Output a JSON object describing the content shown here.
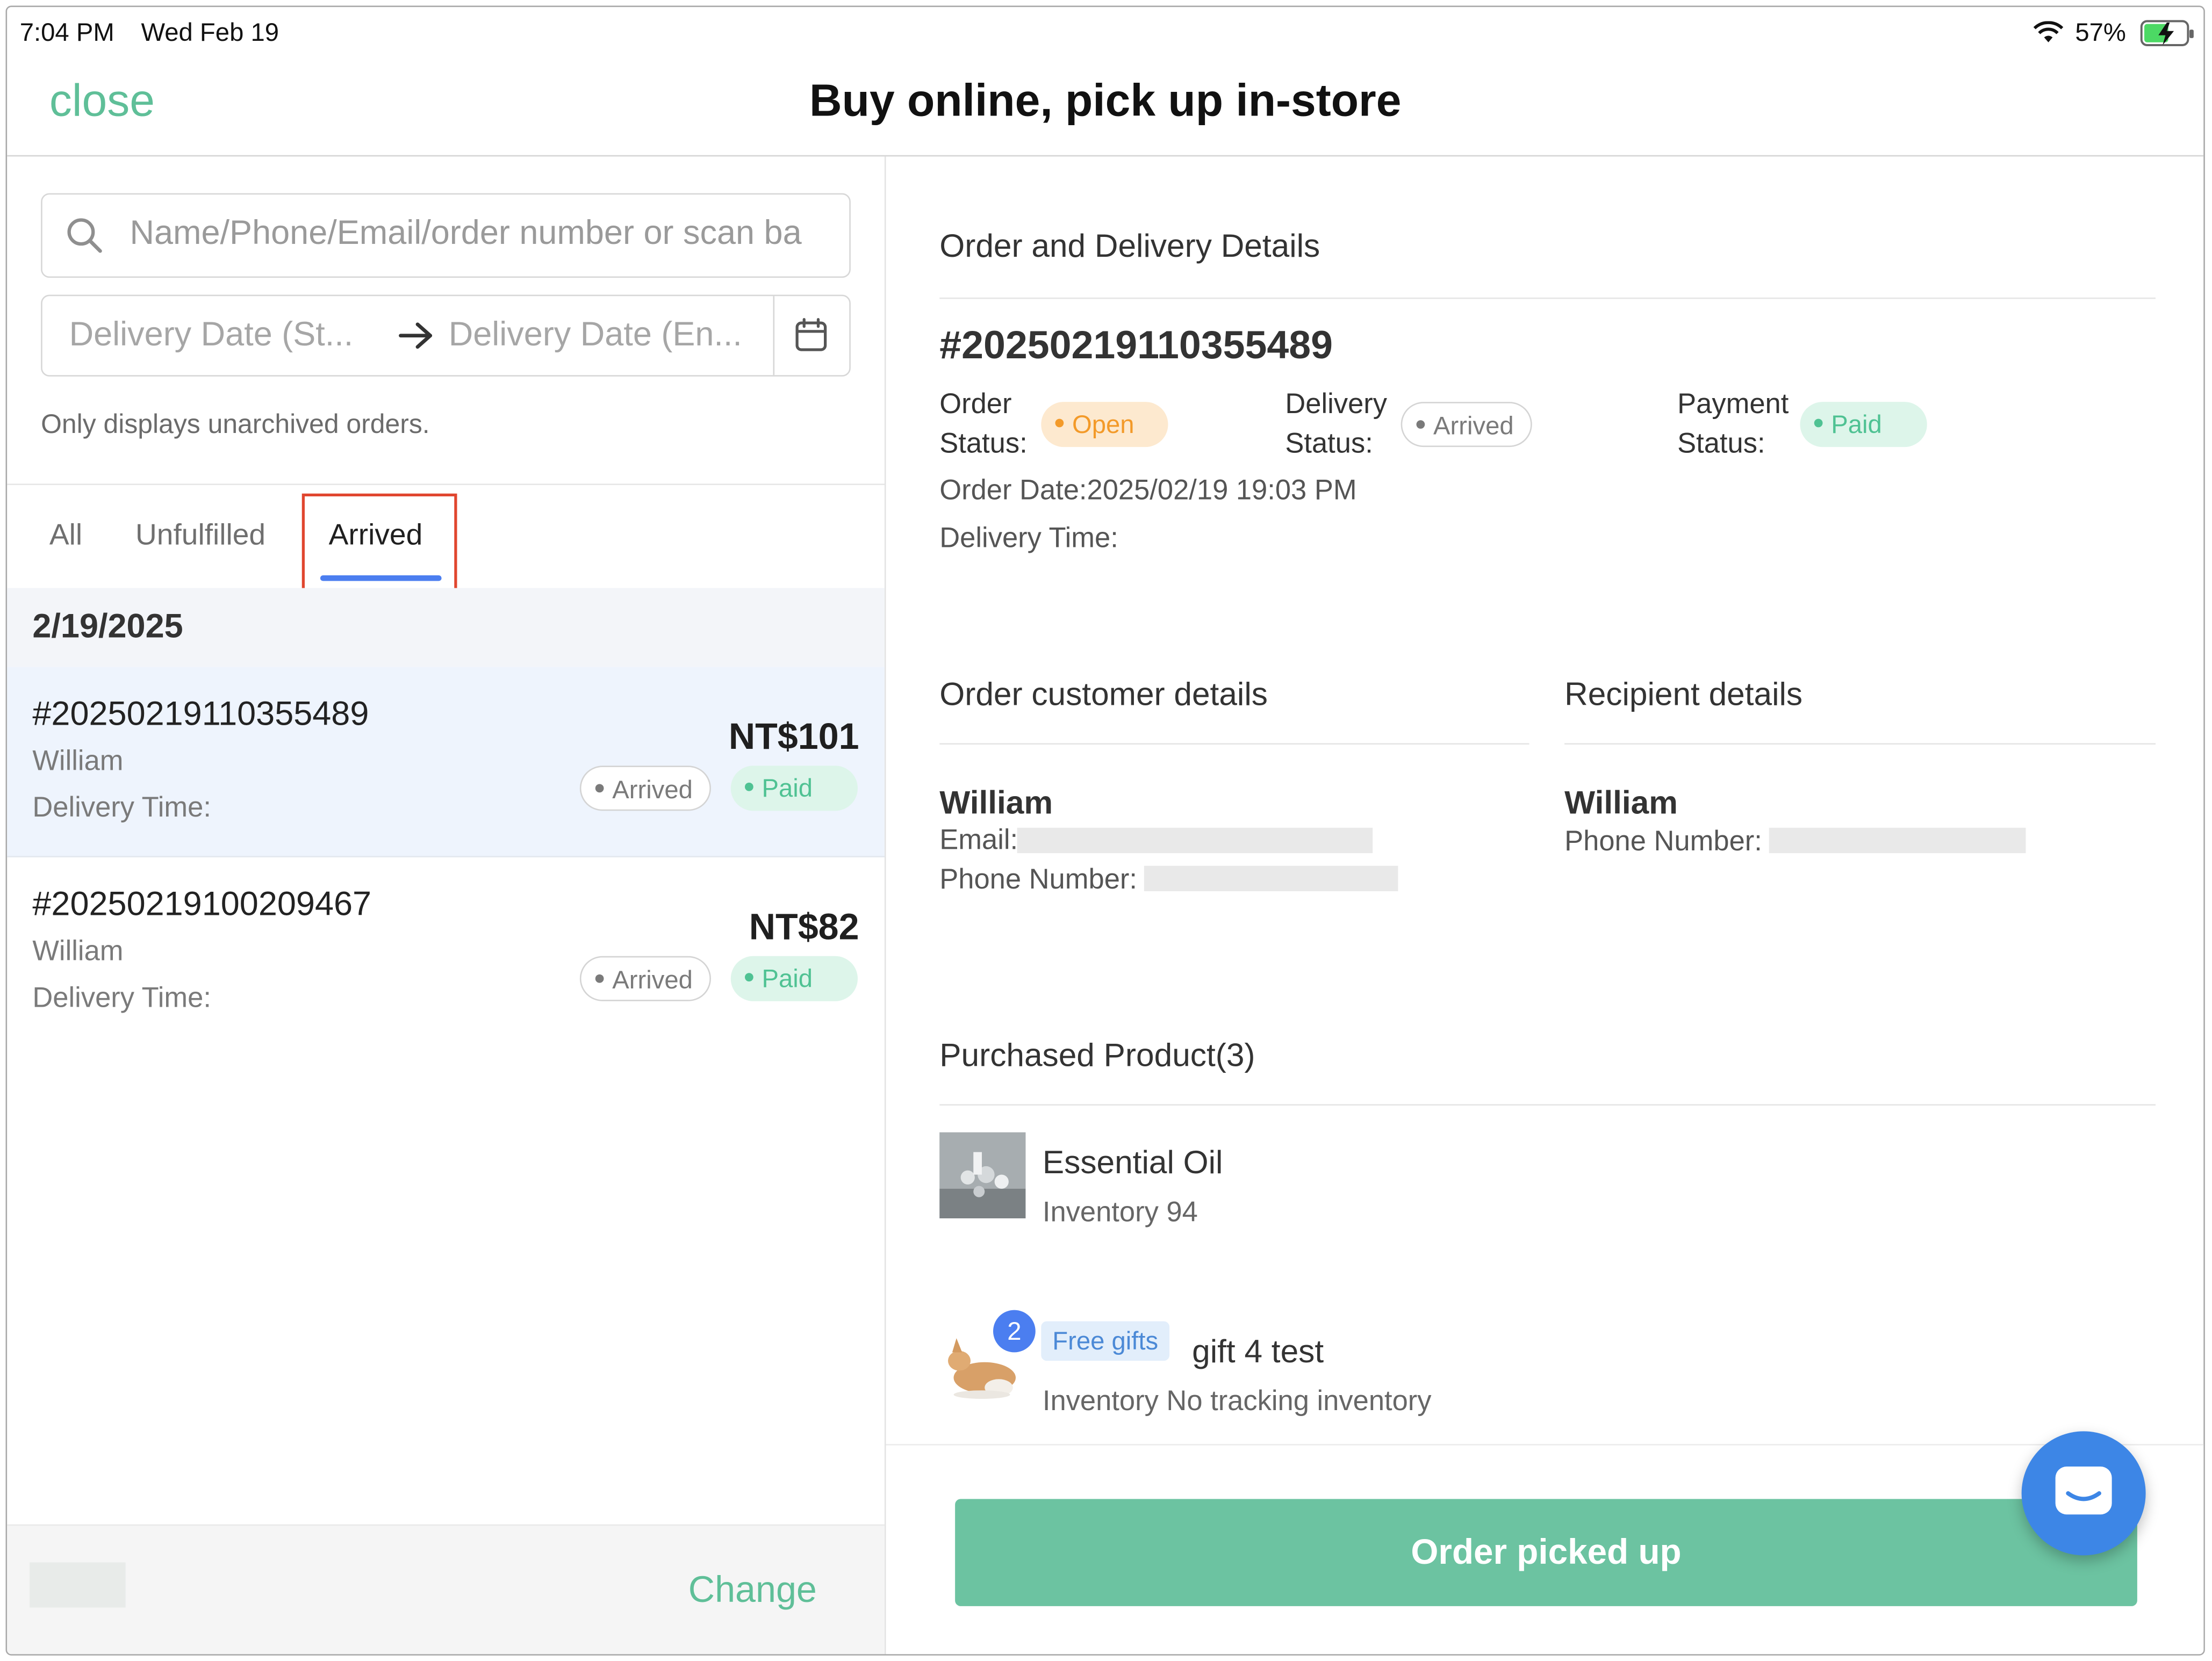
{
  "status_bar": {
    "time": "7:04 PM",
    "date": "Wed Feb 19",
    "battery": "57%"
  },
  "header": {
    "close_label": "close",
    "title": "Buy online, pick up in-store"
  },
  "left": {
    "search_placeholder": "Name/Phone/Email/order number or scan ba",
    "date_start_placeholder": "Delivery Date (St...",
    "date_end_placeholder": "Delivery Date (En...",
    "hint": "Only displays unarchived orders.",
    "tabs": [
      "All",
      "Unfulfilled",
      "Arrived"
    ],
    "active_tab": "Arrived",
    "group_date": "2/19/2025",
    "orders": [
      {
        "number": "#20250219110355489",
        "customer": "William",
        "delivery_time_label": "Delivery Time:",
        "amount": "NT$101",
        "delivery_status": "Arrived",
        "payment_status": "Paid",
        "selected": true
      },
      {
        "number": "#20250219100209467",
        "customer": "William",
        "delivery_time_label": "Delivery Time:",
        "amount": "NT$82",
        "delivery_status": "Arrived",
        "payment_status": "Paid",
        "selected": false
      }
    ],
    "footer": {
      "change_label": "Change"
    }
  },
  "detail": {
    "section_title": "Order and Delivery Details",
    "order_number": "#20250219110355489",
    "order_status_label_1": "Order",
    "order_status_label_2": "Status:",
    "order_status": "Open",
    "delivery_status_label_1": "Delivery",
    "delivery_status_label_2": "Status:",
    "delivery_status": "Arrived",
    "payment_status_label_1": "Payment",
    "payment_status_label_2": "Status:",
    "payment_status": "Paid",
    "order_date": "Order Date:2025/02/19 19:03 PM",
    "delivery_time": "Delivery Time:",
    "customer_section_title": "Order customer details",
    "customer_name": "William",
    "customer_email_label": "Email:",
    "customer_phone_label": "Phone Number:",
    "recipient_section_title": "Recipient details",
    "recipient_name": "William",
    "recipient_phone_label": "Phone Number:",
    "products_title": "Purchased Product(3)",
    "products": [
      {
        "name": "Essential Oil",
        "inventory": "Inventory 94"
      },
      {
        "tag": "Free gifts",
        "name": "gift 4 test",
        "inventory": "Inventory No tracking inventory",
        "quantity_badge": "2"
      }
    ],
    "primary_action": "Order picked up"
  },
  "colors": {
    "accent_green": "#5fbf98",
    "button_green": "#6cc3a1",
    "tab_blue": "#4b7ef0",
    "highlight_red": "#e0462f",
    "open_orange": "#f39a29"
  },
  "icons": [
    "search-icon",
    "arrow-right-icon",
    "calendar-icon",
    "wifi-icon",
    "battery-charging-icon",
    "chat-icon"
  ]
}
